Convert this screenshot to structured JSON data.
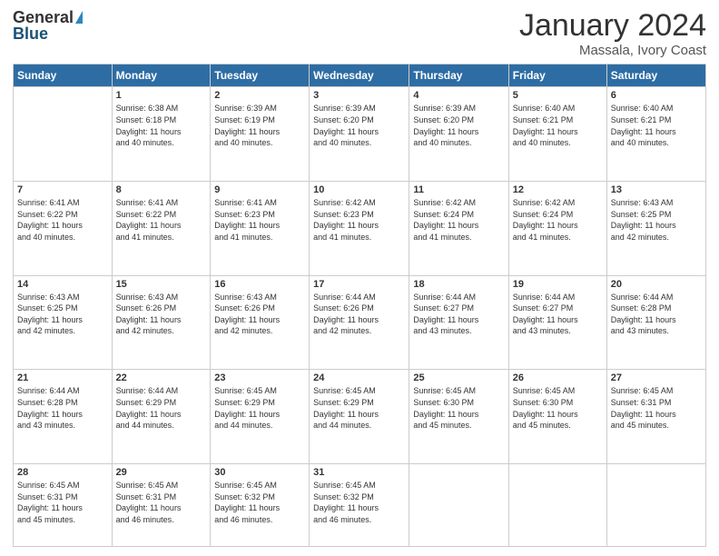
{
  "logo": {
    "general": "General",
    "blue": "Blue"
  },
  "header": {
    "month": "January 2024",
    "location": "Massala, Ivory Coast"
  },
  "weekdays": [
    "Sunday",
    "Monday",
    "Tuesday",
    "Wednesday",
    "Thursday",
    "Friday",
    "Saturday"
  ],
  "weeks": [
    [
      {
        "day": "",
        "sunrise": "",
        "sunset": "",
        "daylight": ""
      },
      {
        "day": "1",
        "sunrise": "Sunrise: 6:38 AM",
        "sunset": "Sunset: 6:18 PM",
        "daylight": "Daylight: 11 hours and 40 minutes."
      },
      {
        "day": "2",
        "sunrise": "Sunrise: 6:39 AM",
        "sunset": "Sunset: 6:19 PM",
        "daylight": "Daylight: 11 hours and 40 minutes."
      },
      {
        "day": "3",
        "sunrise": "Sunrise: 6:39 AM",
        "sunset": "Sunset: 6:20 PM",
        "daylight": "Daylight: 11 hours and 40 minutes."
      },
      {
        "day": "4",
        "sunrise": "Sunrise: 6:39 AM",
        "sunset": "Sunset: 6:20 PM",
        "daylight": "Daylight: 11 hours and 40 minutes."
      },
      {
        "day": "5",
        "sunrise": "Sunrise: 6:40 AM",
        "sunset": "Sunset: 6:21 PM",
        "daylight": "Daylight: 11 hours and 40 minutes."
      },
      {
        "day": "6",
        "sunrise": "Sunrise: 6:40 AM",
        "sunset": "Sunset: 6:21 PM",
        "daylight": "Daylight: 11 hours and 40 minutes."
      }
    ],
    [
      {
        "day": "7",
        "sunrise": "Sunrise: 6:41 AM",
        "sunset": "Sunset: 6:22 PM",
        "daylight": "Daylight: 11 hours and 40 minutes."
      },
      {
        "day": "8",
        "sunrise": "Sunrise: 6:41 AM",
        "sunset": "Sunset: 6:22 PM",
        "daylight": "Daylight: 11 hours and 41 minutes."
      },
      {
        "day": "9",
        "sunrise": "Sunrise: 6:41 AM",
        "sunset": "Sunset: 6:23 PM",
        "daylight": "Daylight: 11 hours and 41 minutes."
      },
      {
        "day": "10",
        "sunrise": "Sunrise: 6:42 AM",
        "sunset": "Sunset: 6:23 PM",
        "daylight": "Daylight: 11 hours and 41 minutes."
      },
      {
        "day": "11",
        "sunrise": "Sunrise: 6:42 AM",
        "sunset": "Sunset: 6:24 PM",
        "daylight": "Daylight: 11 hours and 41 minutes."
      },
      {
        "day": "12",
        "sunrise": "Sunrise: 6:42 AM",
        "sunset": "Sunset: 6:24 PM",
        "daylight": "Daylight: 11 hours and 41 minutes."
      },
      {
        "day": "13",
        "sunrise": "Sunrise: 6:43 AM",
        "sunset": "Sunset: 6:25 PM",
        "daylight": "Daylight: 11 hours and 42 minutes."
      }
    ],
    [
      {
        "day": "14",
        "sunrise": "Sunrise: 6:43 AM",
        "sunset": "Sunset: 6:25 PM",
        "daylight": "Daylight: 11 hours and 42 minutes."
      },
      {
        "day": "15",
        "sunrise": "Sunrise: 6:43 AM",
        "sunset": "Sunset: 6:26 PM",
        "daylight": "Daylight: 11 hours and 42 minutes."
      },
      {
        "day": "16",
        "sunrise": "Sunrise: 6:43 AM",
        "sunset": "Sunset: 6:26 PM",
        "daylight": "Daylight: 11 hours and 42 minutes."
      },
      {
        "day": "17",
        "sunrise": "Sunrise: 6:44 AM",
        "sunset": "Sunset: 6:26 PM",
        "daylight": "Daylight: 11 hours and 42 minutes."
      },
      {
        "day": "18",
        "sunrise": "Sunrise: 6:44 AM",
        "sunset": "Sunset: 6:27 PM",
        "daylight": "Daylight: 11 hours and 43 minutes."
      },
      {
        "day": "19",
        "sunrise": "Sunrise: 6:44 AM",
        "sunset": "Sunset: 6:27 PM",
        "daylight": "Daylight: 11 hours and 43 minutes."
      },
      {
        "day": "20",
        "sunrise": "Sunrise: 6:44 AM",
        "sunset": "Sunset: 6:28 PM",
        "daylight": "Daylight: 11 hours and 43 minutes."
      }
    ],
    [
      {
        "day": "21",
        "sunrise": "Sunrise: 6:44 AM",
        "sunset": "Sunset: 6:28 PM",
        "daylight": "Daylight: 11 hours and 43 minutes."
      },
      {
        "day": "22",
        "sunrise": "Sunrise: 6:44 AM",
        "sunset": "Sunset: 6:29 PM",
        "daylight": "Daylight: 11 hours and 44 minutes."
      },
      {
        "day": "23",
        "sunrise": "Sunrise: 6:45 AM",
        "sunset": "Sunset: 6:29 PM",
        "daylight": "Daylight: 11 hours and 44 minutes."
      },
      {
        "day": "24",
        "sunrise": "Sunrise: 6:45 AM",
        "sunset": "Sunset: 6:29 PM",
        "daylight": "Daylight: 11 hours and 44 minutes."
      },
      {
        "day": "25",
        "sunrise": "Sunrise: 6:45 AM",
        "sunset": "Sunset: 6:30 PM",
        "daylight": "Daylight: 11 hours and 45 minutes."
      },
      {
        "day": "26",
        "sunrise": "Sunrise: 6:45 AM",
        "sunset": "Sunset: 6:30 PM",
        "daylight": "Daylight: 11 hours and 45 minutes."
      },
      {
        "day": "27",
        "sunrise": "Sunrise: 6:45 AM",
        "sunset": "Sunset: 6:31 PM",
        "daylight": "Daylight: 11 hours and 45 minutes."
      }
    ],
    [
      {
        "day": "28",
        "sunrise": "Sunrise: 6:45 AM",
        "sunset": "Sunset: 6:31 PM",
        "daylight": "Daylight: 11 hours and 45 minutes."
      },
      {
        "day": "29",
        "sunrise": "Sunrise: 6:45 AM",
        "sunset": "Sunset: 6:31 PM",
        "daylight": "Daylight: 11 hours and 46 minutes."
      },
      {
        "day": "30",
        "sunrise": "Sunrise: 6:45 AM",
        "sunset": "Sunset: 6:32 PM",
        "daylight": "Daylight: 11 hours and 46 minutes."
      },
      {
        "day": "31",
        "sunrise": "Sunrise: 6:45 AM",
        "sunset": "Sunset: 6:32 PM",
        "daylight": "Daylight: 11 hours and 46 minutes."
      },
      {
        "day": "",
        "sunrise": "",
        "sunset": "",
        "daylight": ""
      },
      {
        "day": "",
        "sunrise": "",
        "sunset": "",
        "daylight": ""
      },
      {
        "day": "",
        "sunrise": "",
        "sunset": "",
        "daylight": ""
      }
    ]
  ]
}
